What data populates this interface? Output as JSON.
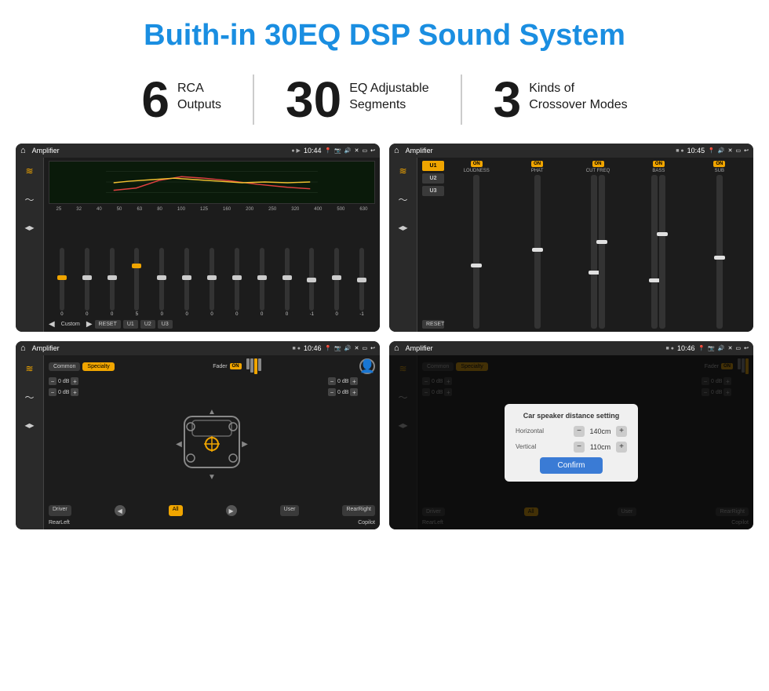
{
  "page": {
    "title": "Buith-in 30EQ DSP Sound System"
  },
  "stats": [
    {
      "number": "6",
      "label_line1": "RCA",
      "label_line2": "Outputs"
    },
    {
      "number": "30",
      "label_line1": "EQ Adjustable",
      "label_line2": "Segments"
    },
    {
      "number": "3",
      "label_line1": "Kinds of",
      "label_line2": "Crossover Modes"
    }
  ],
  "screens": [
    {
      "id": "screen1",
      "statusBar": {
        "title": "Amplifier",
        "time": "10:44"
      },
      "type": "eq",
      "presetLabel": "Custom",
      "eqBands": [
        "25",
        "32",
        "40",
        "50",
        "63",
        "80",
        "100",
        "125",
        "160",
        "200",
        "250",
        "320",
        "400",
        "500",
        "630"
      ],
      "eqValues": [
        "0",
        "0",
        "0",
        "5",
        "0",
        "0",
        "0",
        "0",
        "0",
        "0",
        "-1",
        "0",
        "-1"
      ],
      "bottomBtns": [
        "RESET",
        "U1",
        "U2",
        "U3"
      ]
    },
    {
      "id": "screen2",
      "statusBar": {
        "title": "Amplifier",
        "time": "10:45"
      },
      "type": "amp",
      "presets": [
        "U1",
        "U2",
        "U3"
      ],
      "channels": [
        {
          "label": "LOUDNESS",
          "on": true
        },
        {
          "label": "PHAT",
          "on": true
        },
        {
          "label": "CUT FREQ",
          "on": true
        },
        {
          "label": "BASS",
          "on": true
        },
        {
          "label": "SUB",
          "on": true
        }
      ],
      "resetLabel": "RESET"
    },
    {
      "id": "screen3",
      "statusBar": {
        "title": "Amplifier",
        "time": "10:46"
      },
      "type": "fader",
      "tabs": [
        "Common",
        "Specialty"
      ],
      "activeTab": "Specialty",
      "faderLabel": "Fader",
      "faderOn": "ON",
      "levels": [
        {
          "value": "0 dB"
        },
        {
          "value": "0 dB"
        },
        {
          "value": "0 dB"
        },
        {
          "value": "0 dB"
        }
      ],
      "bottomBtns": [
        "Driver",
        "",
        "All",
        "",
        "User",
        "RearRight"
      ],
      "rearLabels": [
        "RearLeft",
        "Copilot"
      ]
    },
    {
      "id": "screen4",
      "statusBar": {
        "title": "Amplifier",
        "time": "10:46"
      },
      "type": "fader-dialog",
      "tabs": [
        "Common",
        "Specialty"
      ],
      "activeTab": "Specialty",
      "dialog": {
        "title": "Car speaker distance setting",
        "fields": [
          {
            "label": "Horizontal",
            "value": "140cm"
          },
          {
            "label": "Vertical",
            "value": "110cm"
          }
        ],
        "confirmLabel": "Confirm"
      },
      "rearLabels": [
        "RearLeft",
        "Copilot"
      ],
      "bottomBtns": [
        "Driver",
        "User",
        "RearRight"
      ]
    }
  ]
}
